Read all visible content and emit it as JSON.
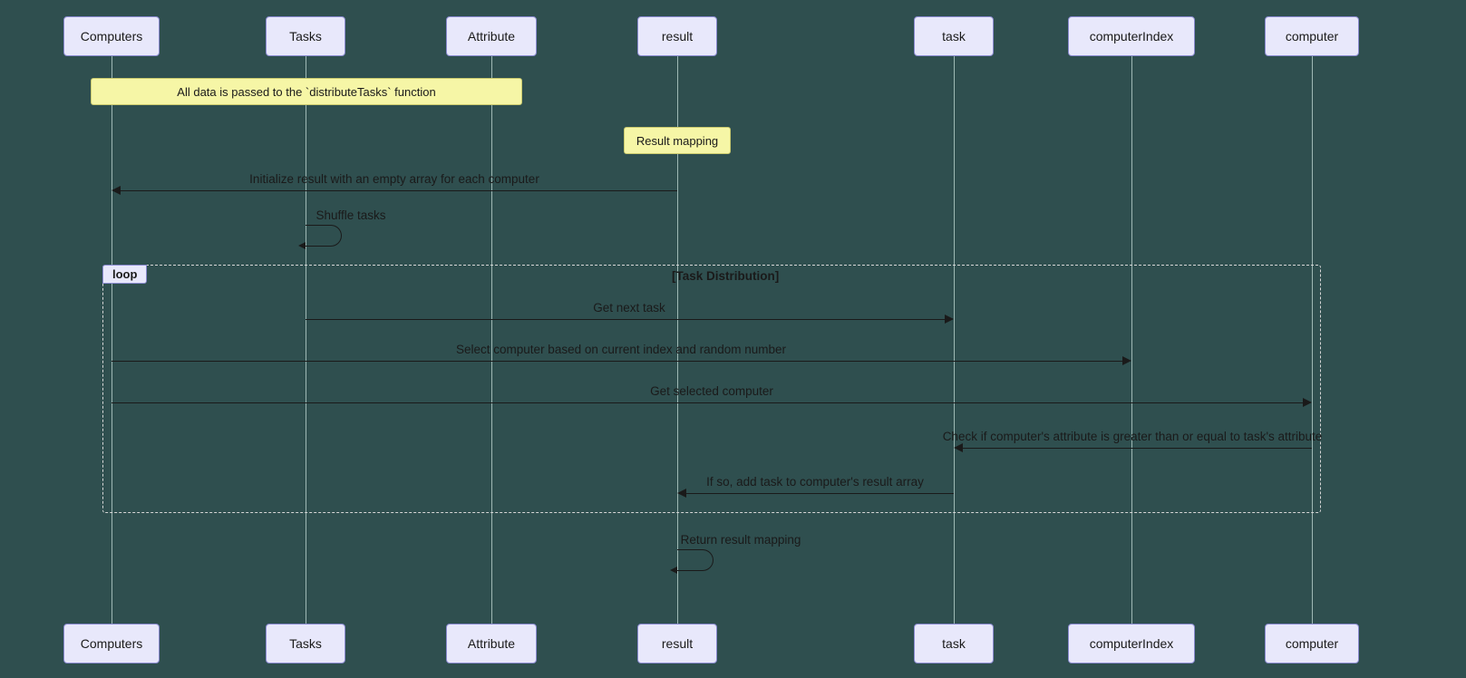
{
  "actors": {
    "computers": "Computers",
    "tasks": "Tasks",
    "attribute": "Attribute",
    "result": "result",
    "task": "task",
    "computerIndex": "computerIndex",
    "computer": "computer"
  },
  "notes": {
    "n1": "All data is passed to the `distributeTasks` function",
    "n2": "Result mapping"
  },
  "loop": {
    "tag": "loop",
    "title": "[Task Distribution]"
  },
  "messages": {
    "m1": "Initialize result with an empty array for each computer",
    "m2": "Shuffle tasks",
    "m3": "Get next task",
    "m4": "Select computer based on current index and random number",
    "m5": "Get selected computer",
    "m6": "Check if computer's attribute is greater than or equal to task's attribute",
    "m7": "If so, add task to computer's result array",
    "m8": "Return result mapping"
  }
}
